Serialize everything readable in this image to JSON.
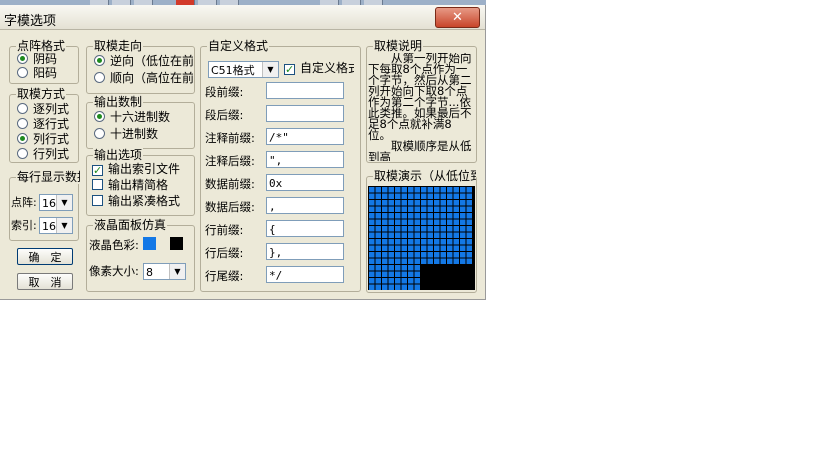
{
  "window": {
    "title": "字模选项",
    "close_icon": "close-icon"
  },
  "dot_format": {
    "title": "点阵格式",
    "options": [
      "阴码",
      "阳码"
    ],
    "selected": 0
  },
  "scan_mode": {
    "title": "取模方式",
    "options": [
      "逐列式",
      "逐行式",
      "列行式",
      "行列式"
    ],
    "selected": 2
  },
  "display_per_row": {
    "title": "每行显示数据",
    "dots_label": "点阵:",
    "dots_value": "16",
    "index_label": "索引:",
    "index_value": "16"
  },
  "buttons": {
    "ok": "确　定",
    "cancel": "取　消"
  },
  "scan_direction": {
    "title": "取模走向",
    "options": [
      "逆向（低位在前",
      "顺向（高位在前"
    ],
    "selected": 0
  },
  "output_base": {
    "title": "输出数制",
    "options": [
      "十六进制数",
      "十进制数"
    ],
    "selected": 0
  },
  "output_options": {
    "title": "输出选项",
    "items": [
      {
        "label": "输出索引文件",
        "checked": true
      },
      {
        "label": "输出精简格",
        "checked": false
      },
      {
        "label": "输出紧凑格式",
        "checked": false
      }
    ]
  },
  "lcd_panel": {
    "title": "液晶面板仿真",
    "color_label": "液晶色彩:",
    "color_fg": "#1378e6",
    "color_bg": "#000000",
    "pixel_label": "像素大小:",
    "pixel_value": "8"
  },
  "custom_format": {
    "title": "自定义格式",
    "format_select": "C51格式",
    "custom_check_label": "自定义格式",
    "custom_checked": true,
    "fields": [
      {
        "label": "段前缀:",
        "value": ""
      },
      {
        "label": "段后缀:",
        "value": ""
      },
      {
        "label": "注释前缀:",
        "value": "/*\""
      },
      {
        "label": "注释后缀:",
        "value": "\","
      },
      {
        "label": "数据前缀:",
        "value": "0x"
      },
      {
        "label": "数据后缀:",
        "value": ","
      },
      {
        "label": "行前缀:",
        "value": "{"
      },
      {
        "label": "行后缀:",
        "value": "},"
      },
      {
        "label": "行尾缀:",
        "value": "*/"
      }
    ]
  },
  "scan_description": {
    "title": "取模说明",
    "text": "　　从第一列开始向下每取8个点作为一个字节，然后从第二列开始向下取8个点作为第二个字节...依此类推。如果最后不足8个点就补满8位。\n　　取模顺序是从低到高"
  },
  "scan_demo": {
    "title": "取模演示（从低位到高位）",
    "grid_color": "#1378e6",
    "bg_color": "#000000"
  }
}
